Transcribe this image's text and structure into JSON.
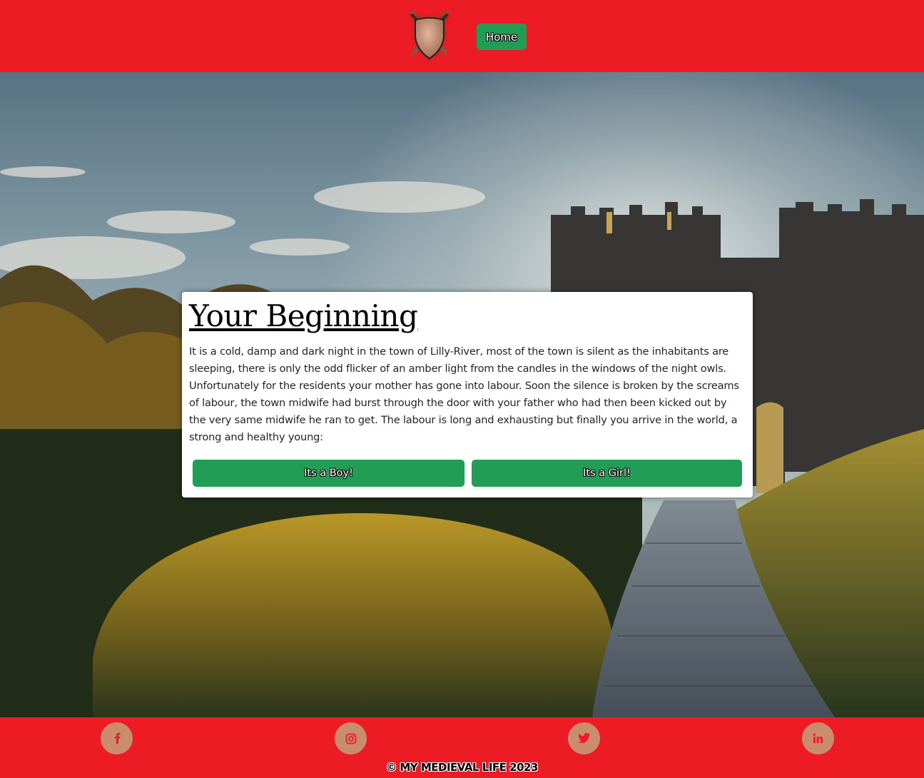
{
  "header": {
    "logo_icon": "shield-with-crossed-swords-icon",
    "nav_home_label": "Home"
  },
  "story": {
    "title": "Your Beginning",
    "text": "It is a cold, damp and dark night in the town of Lilly-River, most of the town is silent as the inhabitants are sleeping, there is only the odd flicker of an amber light from the candles in the windows of the night owls. Unfortunately for the residents your mother has gone into labour. Soon the silence is broken by the screams of labour, the town midwife had burst through the door with your father who had then been kicked out by the very same midwife he ran to get. The labour is long and exhausting but finally you arrive in the world, a strong and healthy young:",
    "choice_boy_label": "Its a Boy!",
    "choice_girl_label": "Its a Girl!"
  },
  "footer": {
    "social_icons": [
      "facebook-icon",
      "instagram-icon",
      "twitter-icon",
      "linkedin-icon"
    ],
    "copyright": "© MY MEDIEVAL LIFE 2023"
  },
  "colors": {
    "brand_red": "#ed1c24",
    "button_green": "#219d55",
    "social_circle": "#c98d6d"
  }
}
